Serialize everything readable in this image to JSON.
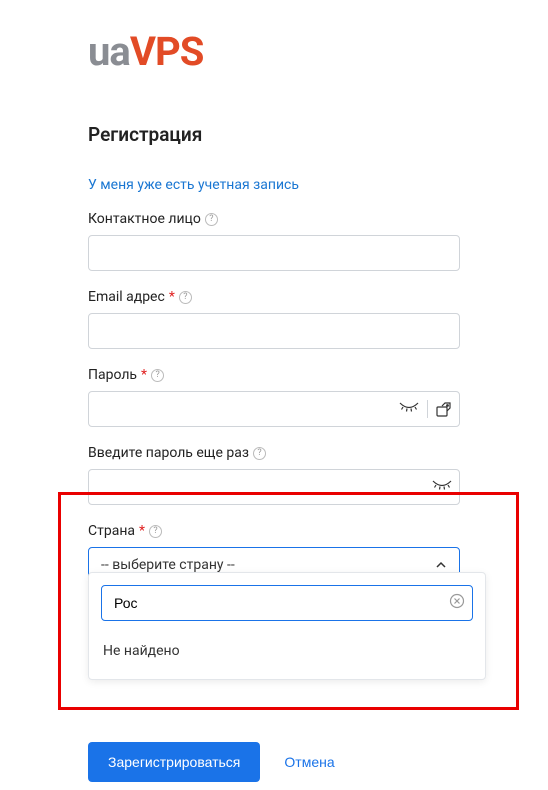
{
  "logo": {
    "part1": "ua",
    "part2": "VPS"
  },
  "title": "Регистрация",
  "login_link": "У меня уже есть учетная запись",
  "fields": {
    "contact": {
      "label": "Контактное лицо",
      "required": false
    },
    "email": {
      "label": "Email адрес",
      "required": true
    },
    "password": {
      "label": "Пароль",
      "required": true
    },
    "password2": {
      "label": "Введите пароль еще раз",
      "required": false
    },
    "country": {
      "label": "Страна",
      "required": true,
      "placeholder": "-- выберите страну --"
    }
  },
  "dropdown": {
    "search_value": "Рос",
    "no_results": "Не найдено"
  },
  "buttons": {
    "submit": "Зарегистрироваться",
    "cancel": "Отмена"
  },
  "help_glyph": "?"
}
